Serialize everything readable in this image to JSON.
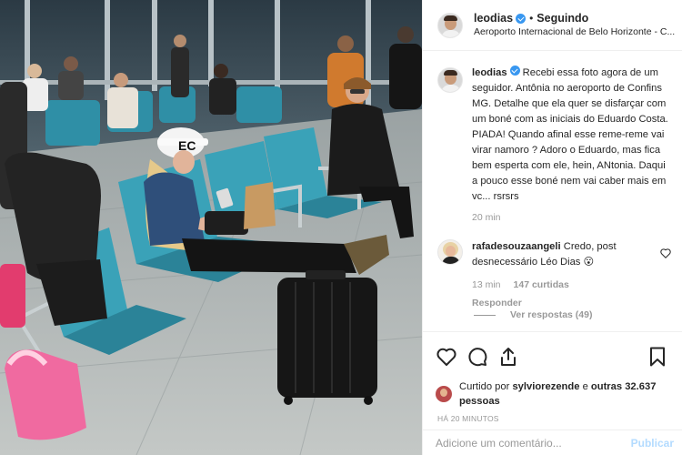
{
  "header": {
    "username": "leodias",
    "separator": "•",
    "follow_status": "Seguindo",
    "location": "Aeroporto Internacional de Belo Horizonte - C..."
  },
  "caption": {
    "username": "leodias",
    "text": "Recebi essa foto agora de um seguidor. Antônia no aeroporto de Confins MG. Detalhe que ela quer se disfarçar com um boné com as iniciais do Eduardo Costa. PIADA! Quando afinal esse reme-reme vai virar namoro ? Adoro o Eduardo, mas fica bem esperta com ele, hein, ANtonia. Daqui a pouco esse boné nem vai caber mais em vc... rsrsrs",
    "time": "20 min"
  },
  "comment": {
    "username": "rafadesouzaangeli",
    "text": "Credo, post desnecessário Léo Dias",
    "emoji": "😮",
    "time": "13 min",
    "likes": "147 curtidas",
    "reply_label": "Responder",
    "view_replies": "Ver respostas (49)"
  },
  "likes": {
    "prefix": "Curtido por",
    "user": "sylviorezende",
    "conjunction": "e",
    "others": "outras 32.637 pessoas"
  },
  "post_time": "HÁ 20 MINUTOS",
  "add_comment": {
    "placeholder": "Adicione um comentário...",
    "post_label": "Publicar"
  },
  "photo": {
    "cap_text": "EC"
  },
  "icons": {
    "like": "heart-icon",
    "comment": "comment-icon",
    "share": "share-icon",
    "save": "bookmark-icon"
  },
  "colors": {
    "verified": "#3897f0",
    "muted": "#999999",
    "post_button": "#b3dbff",
    "seat": "#2f8fa6"
  }
}
